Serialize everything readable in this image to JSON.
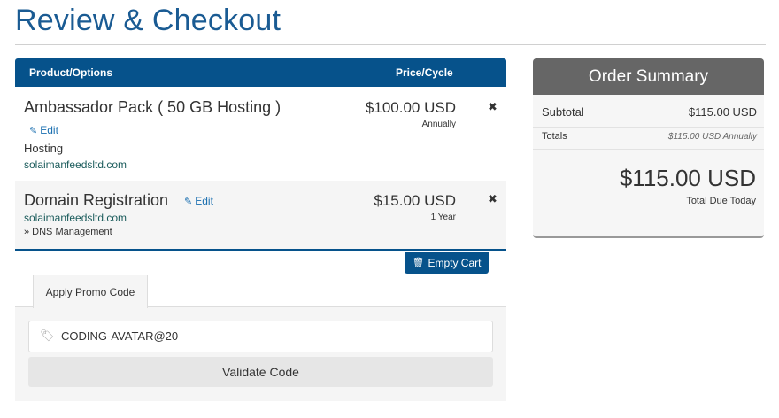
{
  "page": {
    "title": "Review & Checkout"
  },
  "cart": {
    "header": {
      "product_col": "Product/Options",
      "price_col": "Price/Cycle"
    },
    "items": [
      {
        "name": "Ambassador Pack ( 50 GB Hosting )",
        "edit_label": "Edit",
        "group": "Hosting",
        "domain": "solaimanfeedsltd.com",
        "price": "$100.00 USD",
        "cycle": "Annually",
        "remove": "✖"
      },
      {
        "name": "Domain Registration",
        "edit_label": "Edit",
        "domain": "solaimanfeedsltd.com",
        "addon": "» DNS Management",
        "price": "$15.00 USD",
        "cycle": "1 Year",
        "remove": "✖"
      }
    ],
    "empty_cart_label": "Empty Cart"
  },
  "promo": {
    "tab_label": "Apply Promo Code",
    "code_value": "CODING-AVATAR@20",
    "validate_label": "Validate Code"
  },
  "summary": {
    "title": "Order Summary",
    "subtotal_label": "Subtotal",
    "subtotal_value": "$115.00 USD",
    "totals_label": "Totals",
    "totals_value": "$115.00 USD Annually",
    "total_due": "$115.00 USD",
    "total_due_label": "Total Due Today"
  },
  "icons": {
    "edit": "pencil-icon",
    "remove": "close-icon",
    "empty_cart": "trash-icon",
    "promo": "tag-icon"
  },
  "colors": {
    "brand": "#06528b",
    "title": "#1a5b93",
    "summary_header": "#666666"
  }
}
